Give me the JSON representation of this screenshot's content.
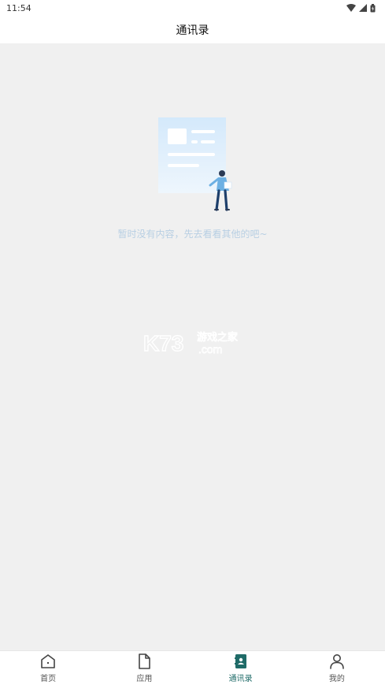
{
  "status_bar": {
    "time": "11:54"
  },
  "header": {
    "title": "通讯录"
  },
  "empty_state": {
    "message": "暂时没有内容，先去看看其他的吧~"
  },
  "watermark": {
    "brand": "K73",
    "text": "游戏之家",
    "domain": ".com"
  },
  "tabs": [
    {
      "label": "首页",
      "icon": "home-icon",
      "active": false
    },
    {
      "label": "应用",
      "icon": "document-icon",
      "active": false
    },
    {
      "label": "通讯录",
      "icon": "contacts-icon",
      "active": true
    },
    {
      "label": "我的",
      "icon": "user-icon",
      "active": false
    }
  ],
  "colors": {
    "accent": "#1f6b68",
    "empty_text": "#b8cfe3",
    "background": "#f0f0f0"
  }
}
